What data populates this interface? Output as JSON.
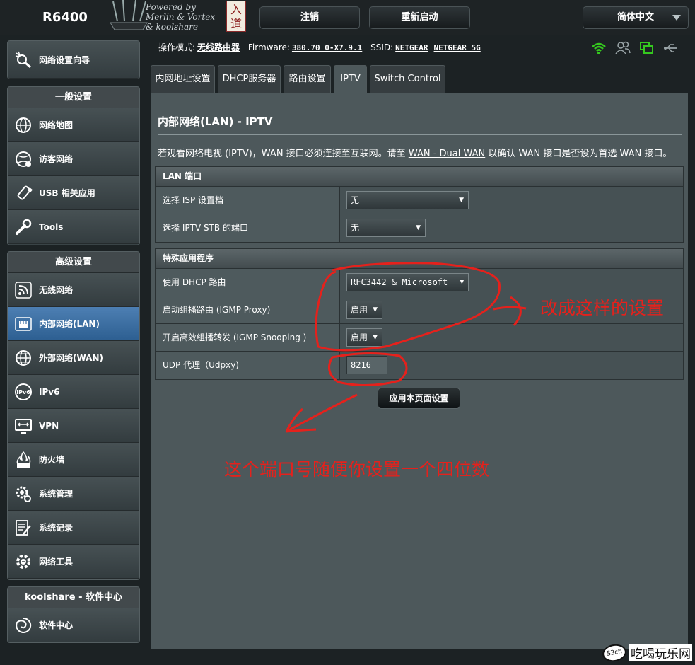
{
  "header": {
    "model": "R6400",
    "powered_lines": [
      "Powered by",
      "Merlin & Vortex",
      "& koolshare"
    ],
    "badge_text": "入道",
    "logout_label": "注销",
    "reboot_label": "重新启动",
    "language": "简体中文"
  },
  "status": {
    "mode_label": "操作模式:",
    "mode_value": "无线路由器",
    "fw_label": "Firmware:",
    "fw_value": "380.70_0-X7.9.1",
    "ssid_label": "SSID:",
    "ssid_1": "NETGEAR",
    "ssid_2": "NETGEAR_5G"
  },
  "sidebar": {
    "wizard": "网络设置向导",
    "general_title": "一般设置",
    "general": [
      "网络地图",
      "访客网络",
      "USB 相关应用",
      "Tools"
    ],
    "advanced_title": "高级设置",
    "advanced": [
      "无线网络",
      "内部网络(LAN)",
      "外部网络(WAN)",
      "IPv6",
      "VPN",
      "防火墙",
      "系统管理",
      "系统记录",
      "网络工具"
    ],
    "kool_title": "koolshare - 软件中心",
    "kool": [
      "软件中心"
    ]
  },
  "tabs": [
    "内网地址设置",
    "DHCP服务器",
    "路由设置",
    "IPTV",
    "Switch Control"
  ],
  "page": {
    "title": "内部网络(LAN) - IPTV",
    "desc_before": "若观看网络电视 (IPTV)，WAN 接口必须连接至互联网。请至 ",
    "desc_link": "WAN - Dual WAN",
    "desc_after": " 以确认 WAN 接口是否设为首选 WAN 接口。"
  },
  "lan_port": {
    "title": "LAN 端口",
    "isp_label": "选择 ISP 设置档",
    "isp_value": "无",
    "stb_label": "选择 IPTV STB 的端口",
    "stb_value": "无"
  },
  "special": {
    "title": "特殊应用程序",
    "dhcp_label": "使用 DHCP 路由",
    "dhcp_value": "RFC3442 & Microsoft",
    "igmp_proxy_label": "启动组播路由 (IGMP Proxy)",
    "igmp_proxy_value": "启用",
    "igmp_snoop_label": "开启高效组播转发 (IGMP Snooping )",
    "igmp_snoop_value": "启用",
    "udpxy_label": "UDP 代理（Udpxy)",
    "udpxy_value": "8216"
  },
  "apply_label": "应用本页面设置",
  "annotations": {
    "note1": "改成这样的设置",
    "note2": "这个端口号随便你设置一个四位数",
    "color": "#e5211c"
  },
  "watermark": {
    "bubble": "S3ch",
    "text": "吃喝玩乐网"
  },
  "colors": {
    "active_item": "#3d6fa3",
    "panel": "#4d585b",
    "status_green": "#35c81f"
  }
}
